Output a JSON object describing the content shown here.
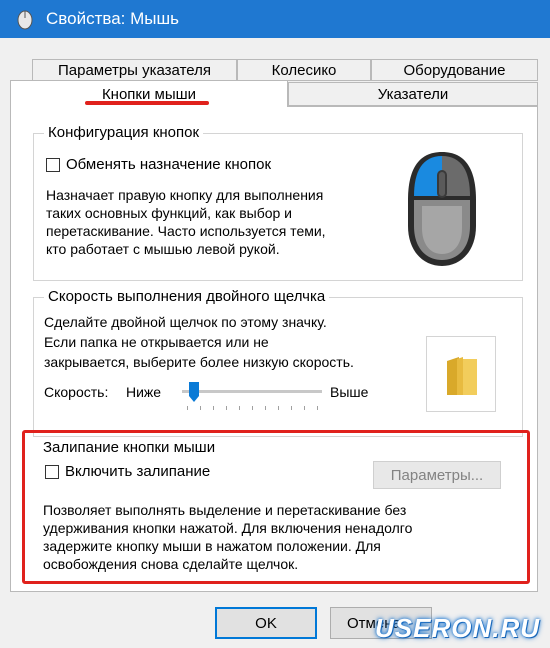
{
  "window": {
    "title": "Свойства: Мышь"
  },
  "tabs": {
    "row1": [
      "Параметры указателя",
      "Колесико",
      "Оборудование"
    ],
    "row2": [
      "Кнопки мыши",
      "Указатели"
    ],
    "active": "Кнопки мыши"
  },
  "buttons_config": {
    "legend": "Конфигурация кнопок",
    "checkbox_label": "Обменять назначение кнопок",
    "checked": false,
    "description_lines": [
      "Назначает правую кнопку для выполнения",
      "таких основных функций, как выбор и",
      "перетаскивание. Часто используется теми,",
      "кто работает с мышью левой рукой."
    ]
  },
  "double_click": {
    "legend": "Скорость выполнения двойного щелчка",
    "description_lines": [
      "Сделайте двойной щелчок по этому значку.",
      "Если папка не открывается или не",
      "закрывается, выберите более низкую скорость."
    ],
    "speed_label": "Скорость:",
    "slow_label": "Ниже",
    "fast_label": "Выше",
    "slider_level": 0.05
  },
  "clicklock": {
    "legend": "Залипание кнопки мыши",
    "checkbox_label": "Включить залипание",
    "checked": false,
    "settings_button": "Параметры...",
    "description_lines": [
      "Позволяет выполнять выделение и перетаскивание без",
      "удерживания кнопки нажатой. Для включения ненадолго",
      "задержите кнопку мыши в нажатом положении. Для",
      "освобождения снова сделайте щелчок."
    ]
  },
  "footer": {
    "ok": "OK",
    "cancel": "Отмена"
  },
  "watermark": "USERON.RU",
  "colors": {
    "titlebar": "#1f78d1",
    "highlight_red": "#e0211c",
    "mouse_button_blue": "#1a8ae0"
  }
}
